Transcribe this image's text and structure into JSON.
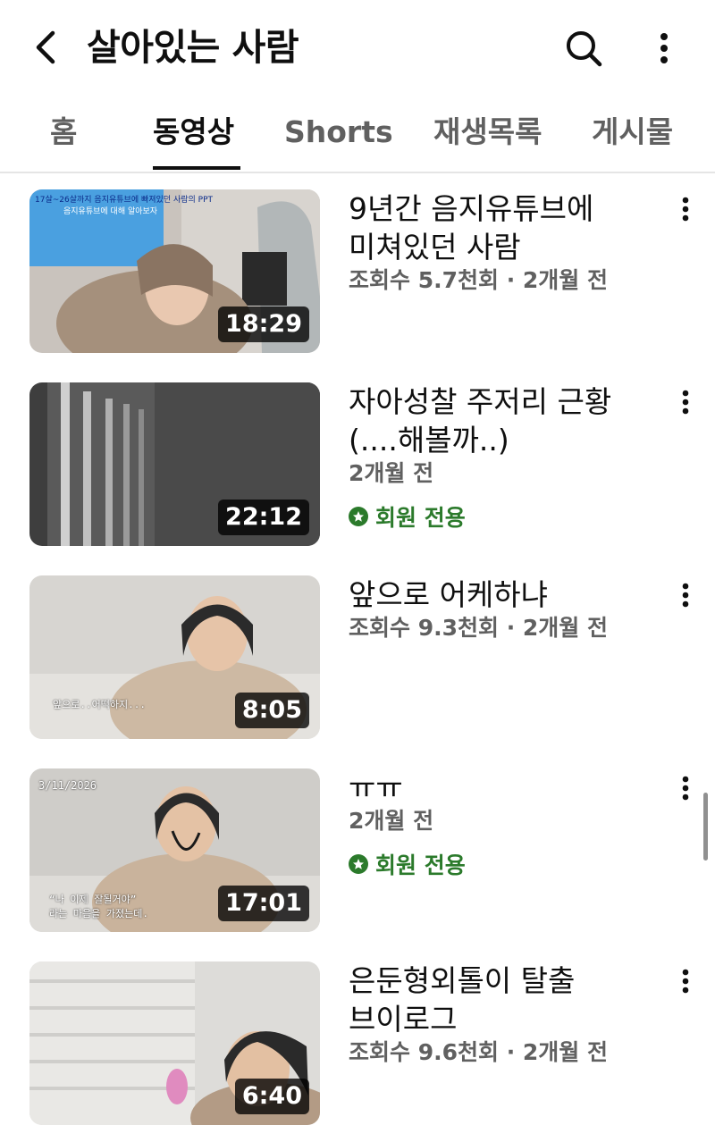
{
  "header": {
    "title": "살아있는 사람",
    "back_icon": "back-arrow-icon",
    "search_icon": "search-icon",
    "more_icon": "more-vert-icon"
  },
  "tabs": [
    {
      "label": "홈",
      "active": false
    },
    {
      "label": "동영상",
      "active": true
    },
    {
      "label": "Shorts",
      "active": false
    },
    {
      "label": "재생목록",
      "active": false
    },
    {
      "label": "게시물",
      "active": false
    }
  ],
  "videos": [
    {
      "title": "9년간 음지유튜브에 미쳐있던 사람",
      "meta": "조회수 5.7천회 · 2개월 전",
      "duration": "18:29",
      "overlay": [
        "17살~26살까지 음지유튜브에 빠져있던 사람의 PPT",
        "음지유튜브에 대해 알아보자"
      ]
    },
    {
      "title": "자아성찰 주저리 근황(....해볼까..)",
      "meta": "2개월 전",
      "duration": "22:12",
      "members_only": "회원 전용"
    },
    {
      "title": "앞으로 어케하냐",
      "meta": "조회수 9.3천회 · 2개월 전",
      "duration": "8:05",
      "overlay": [
        "앞으로..어떡하지..."
      ]
    },
    {
      "title": "ㅠㅠ",
      "meta": "2개월 전",
      "duration": "17:01",
      "members_only": "회원 전용",
      "overlay": [
        "3/11/2026",
        "“나 이제 잘될거야”",
        "라는 마음을 가졌는데."
      ]
    },
    {
      "title": "은둔형외톨이 탈출 브이로그",
      "meta": "조회수 9.6천회 · 2개월 전",
      "duration": "6:40"
    }
  ],
  "colors": {
    "text_primary": "#0f0f0f",
    "text_secondary": "#606060",
    "members_green": "#2b7a2b"
  }
}
